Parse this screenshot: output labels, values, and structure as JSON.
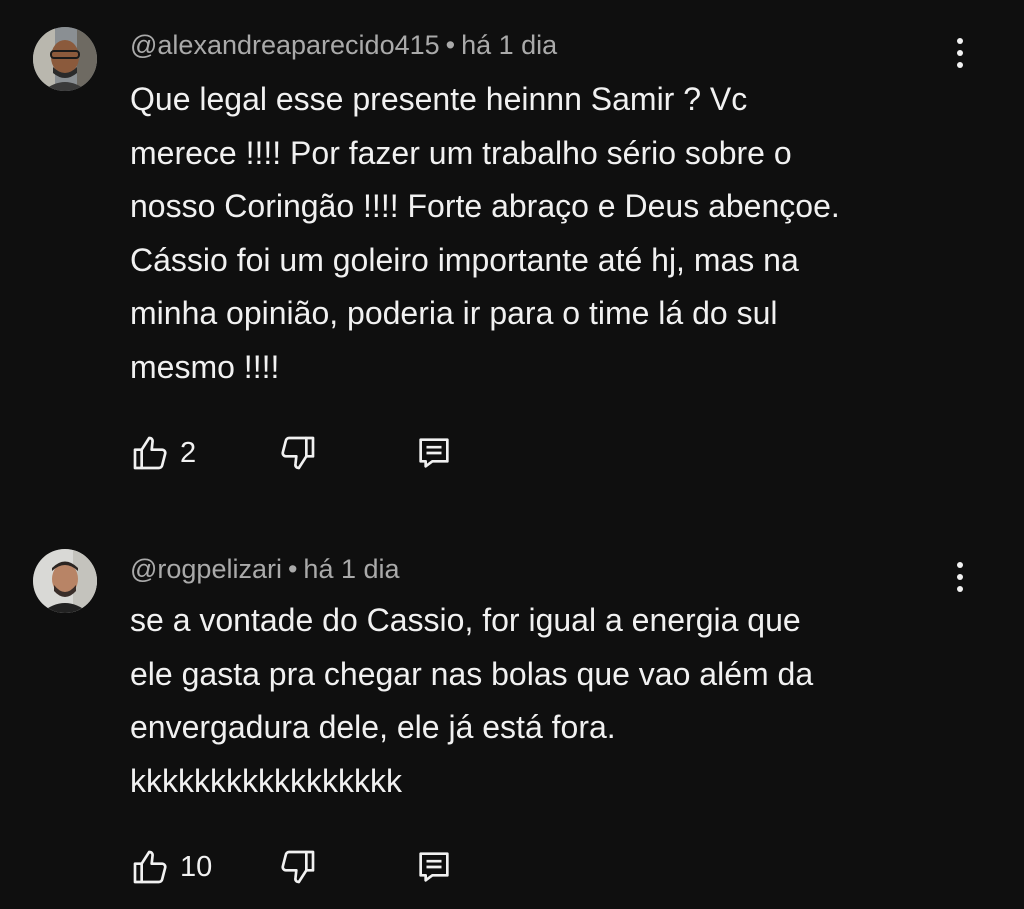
{
  "comments": [
    {
      "handle": "@alexandreaparecido415",
      "separator": "•",
      "time": "há 1 dia",
      "text": "Que legal esse presente heinnn Samir ? Vc\nmerece !!!! Por fazer um trabalho sério sobre o\nnosso Coringão  !!!! Forte abraço e Deus abençoe.\nCássio foi um goleiro importante até hj, mas na\nminha opinião, poderia ir para o time lá do sul\nmesmo !!!!",
      "likes": "2",
      "icons": {
        "avatar": "user-avatar-photo",
        "like": "thumbs-up-icon",
        "dislike": "thumbs-down-icon",
        "reply": "reply-comment-icon",
        "more": "more-vertical-icon"
      }
    },
    {
      "handle": "@rogpelizari",
      "separator": "•",
      "time": "há 1 dia",
      "text": "se a vontade do Cassio, for igual a energia que\nele gasta pra chegar nas bolas que vao além da\nenvergadura dele, ele já está fora.\nkkkkkkkkkkkkkkkkk",
      "likes": "10",
      "icons": {
        "avatar": "user-avatar-photo",
        "like": "thumbs-up-icon",
        "dislike": "thumbs-down-icon",
        "reply": "reply-comment-icon",
        "more": "more-vertical-icon"
      }
    }
  ],
  "colors": {
    "background": "#0f0f0f",
    "text_primary": "#f1f1f1",
    "text_secondary": "#aaaaaa"
  }
}
